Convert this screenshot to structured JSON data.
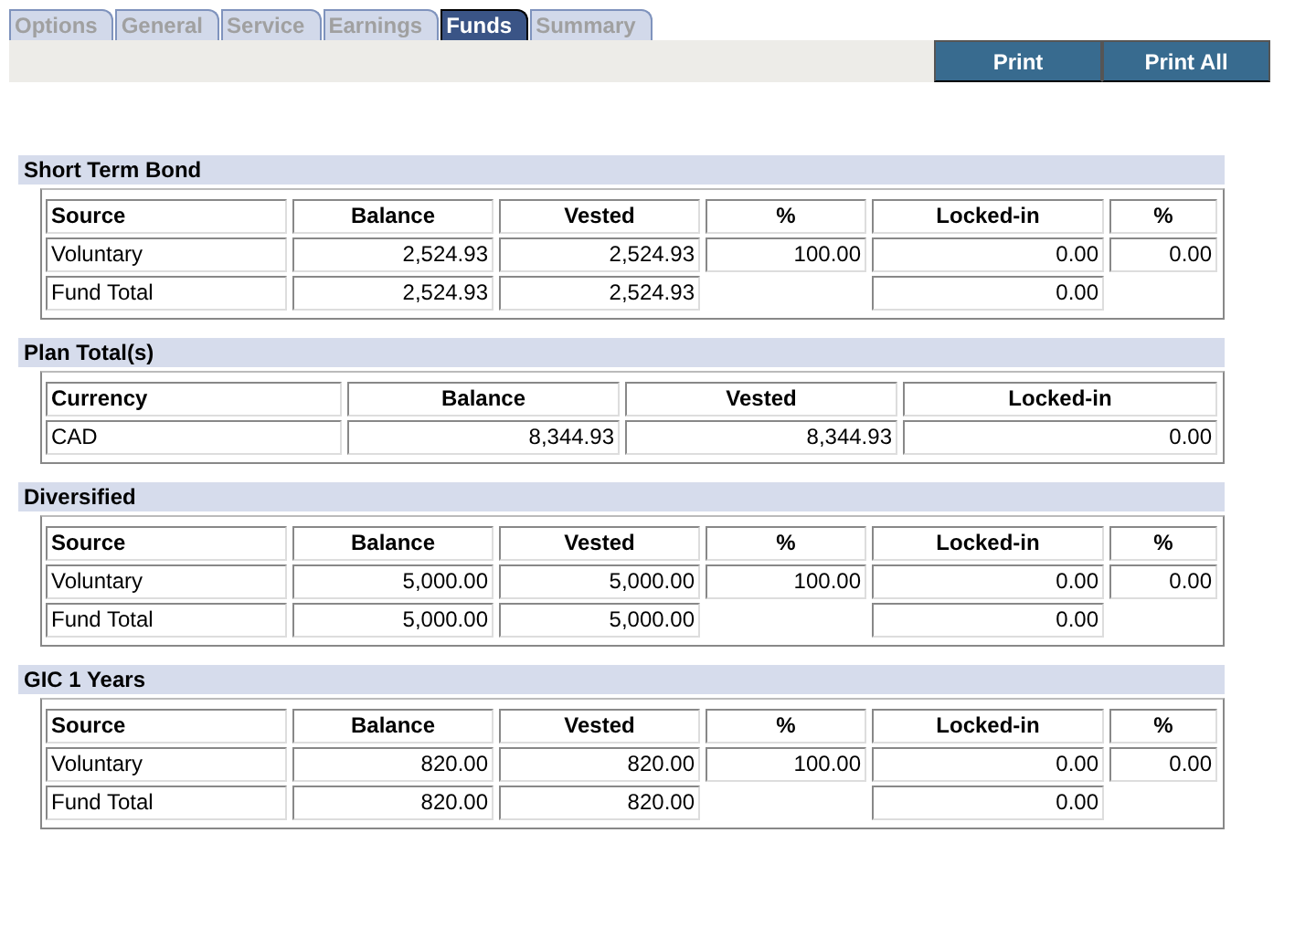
{
  "tabs": [
    {
      "label": "Options",
      "selected": false
    },
    {
      "label": "General",
      "selected": false
    },
    {
      "label": "Service",
      "selected": false
    },
    {
      "label": "Earnings",
      "selected": false
    },
    {
      "label": "Funds",
      "selected": true
    },
    {
      "label": "Summary",
      "selected": false
    }
  ],
  "buttons": [
    "Print",
    "Print All"
  ],
  "sections": [
    {
      "title": "Short Term Bond",
      "kind": "fund",
      "columns": [
        "Source",
        "Balance",
        "Vested",
        "%",
        "Locked-in",
        "%"
      ],
      "rows": [
        {
          "source": "Voluntary",
          "balance": "2,524.93",
          "vested": "2,524.93",
          "percent": "100.00",
          "locked_in": "0.00",
          "locked_percent": "0.00"
        },
        {
          "source": "Fund Total",
          "balance": "2,524.93",
          "vested": "2,524.93",
          "locked_in": "0.00"
        }
      ]
    },
    {
      "title": "Plan Total(s)",
      "kind": "currency",
      "columns": [
        "Currency",
        "Balance",
        "Vested",
        "Locked-in"
      ],
      "rows": [
        {
          "currency": "CAD",
          "balance": "8,344.93",
          "vested": "8,344.93",
          "locked_in": "0.00"
        }
      ]
    },
    {
      "title": "Diversified",
      "kind": "fund",
      "columns": [
        "Source",
        "Balance",
        "Vested",
        "%",
        "Locked-in",
        "%"
      ],
      "rows": [
        {
          "source": "Voluntary",
          "balance": "5,000.00",
          "vested": "5,000.00",
          "percent": "100.00",
          "locked_in": "0.00",
          "locked_percent": "0.00"
        },
        {
          "source": "Fund Total",
          "balance": "5,000.00",
          "vested": "5,000.00",
          "locked_in": "0.00"
        }
      ]
    },
    {
      "title": "GIC 1 Years",
      "kind": "fund",
      "columns": [
        "Source",
        "Balance",
        "Vested",
        "%",
        "Locked-in",
        "%"
      ],
      "rows": [
        {
          "source": "Voluntary",
          "balance": "820.00",
          "vested": "820.00",
          "percent": "100.00",
          "locked_in": "0.00",
          "locked_percent": "0.00"
        },
        {
          "source": "Fund Total",
          "balance": "820.00",
          "vested": "820.00",
          "locked_in": "0.00"
        }
      ]
    }
  ]
}
